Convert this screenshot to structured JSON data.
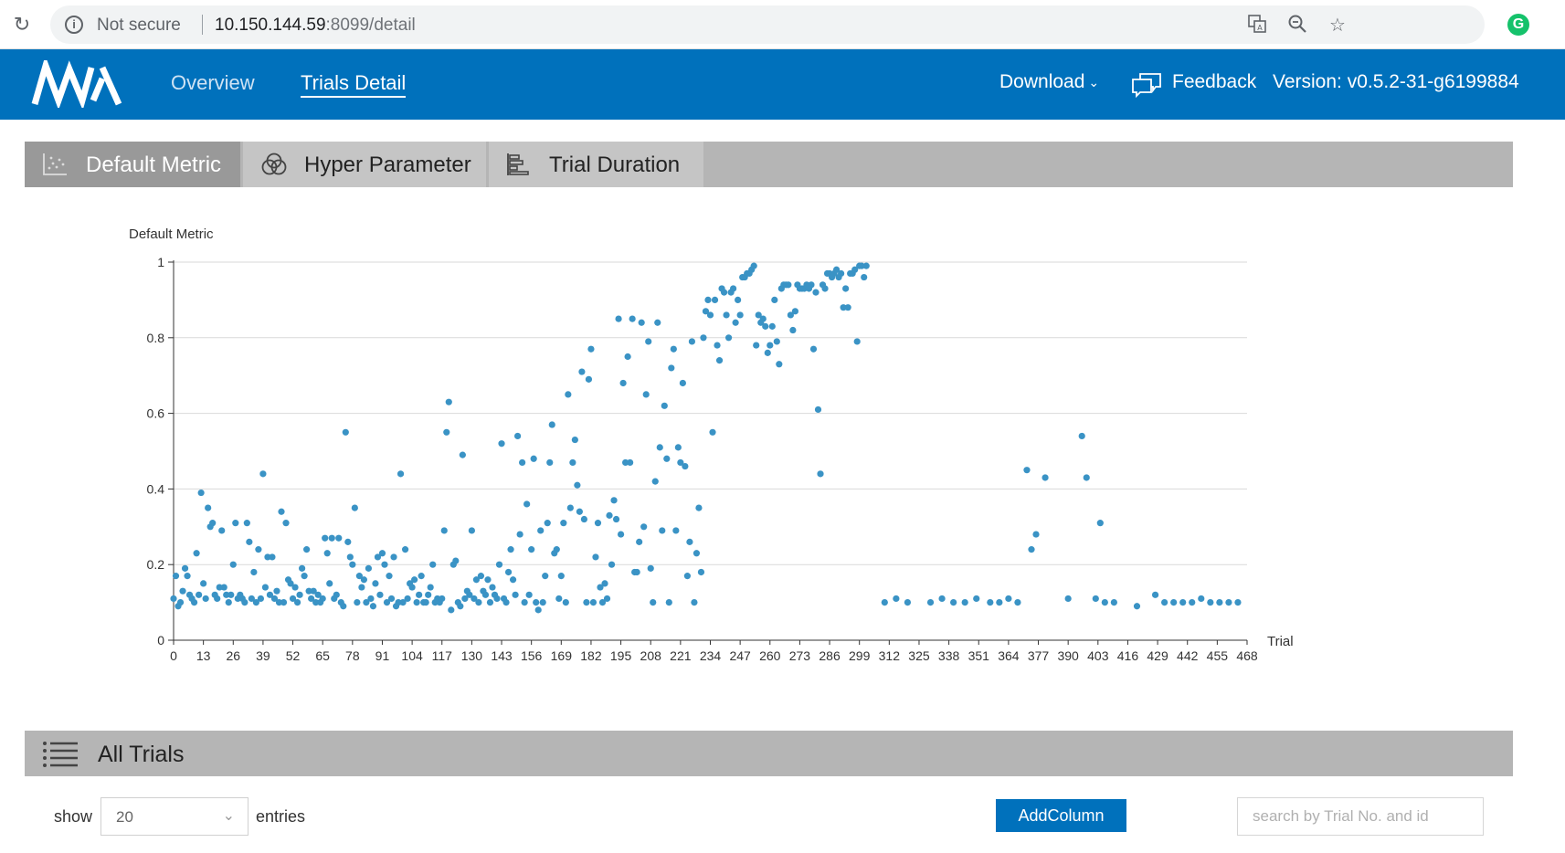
{
  "browser": {
    "security_label": "Not secure",
    "url_host": "10.150.144.59",
    "url_rest": ":8099/detail"
  },
  "header": {
    "nav": [
      {
        "label": "Overview"
      },
      {
        "label": "Trials Detail"
      }
    ],
    "download_label": "Download",
    "feedback_label": "Feedback",
    "version_label": "Version: v0.5.2-31-g6199884"
  },
  "tabs": [
    {
      "label": "Default Metric",
      "active": true
    },
    {
      "label": "Hyper Parameter",
      "active": false
    },
    {
      "label": "Trial Duration",
      "active": false
    }
  ],
  "chart_data": {
    "type": "scatter",
    "ylabel": "Default Metric",
    "xlabel": "Trial",
    "ylim": [
      0,
      1
    ],
    "yticks": [
      "0",
      "0.2",
      "0.4",
      "0.6",
      "0.8",
      "1"
    ],
    "xticks": [
      "0",
      "13",
      "26",
      "39",
      "52",
      "65",
      "78",
      "91",
      "104",
      "117",
      "130",
      "143",
      "156",
      "169",
      "182",
      "195",
      "208",
      "221",
      "234",
      "247",
      "260",
      "273",
      "286",
      "299",
      "312",
      "325",
      "338",
      "351",
      "364",
      "377",
      "390",
      "403",
      "416",
      "429",
      "442",
      "455",
      "468"
    ],
    "grid": true,
    "color": "#3a93c5",
    "points": [
      [
        0,
        0.11
      ],
      [
        1,
        0.17
      ],
      [
        2,
        0.09
      ],
      [
        3,
        0.1
      ],
      [
        4,
        0.13
      ],
      [
        5,
        0.19
      ],
      [
        6,
        0.17
      ],
      [
        7,
        0.12
      ],
      [
        8,
        0.11
      ],
      [
        9,
        0.1
      ],
      [
        10,
        0.23
      ],
      [
        11,
        0.12
      ],
      [
        12,
        0.39
      ],
      [
        13,
        0.15
      ],
      [
        14,
        0.11
      ],
      [
        15,
        0.35
      ],
      [
        16,
        0.3
      ],
      [
        17,
        0.31
      ],
      [
        18,
        0.12
      ],
      [
        19,
        0.11
      ],
      [
        20,
        0.14
      ],
      [
        21,
        0.29
      ],
      [
        22,
        0.14
      ],
      [
        23,
        0.12
      ],
      [
        24,
        0.1
      ],
      [
        25,
        0.12
      ],
      [
        26,
        0.2
      ],
      [
        27,
        0.31
      ],
      [
        28,
        0.11
      ],
      [
        29,
        0.12
      ],
      [
        30,
        0.11
      ],
      [
        31,
        0.1
      ],
      [
        32,
        0.31
      ],
      [
        33,
        0.26
      ],
      [
        34,
        0.11
      ],
      [
        35,
        0.18
      ],
      [
        36,
        0.1
      ],
      [
        37,
        0.24
      ],
      [
        38,
        0.11
      ],
      [
        39,
        0.44
      ],
      [
        40,
        0.14
      ],
      [
        41,
        0.22
      ],
      [
        42,
        0.12
      ],
      [
        43,
        0.22
      ],
      [
        44,
        0.11
      ],
      [
        45,
        0.13
      ],
      [
        46,
        0.1
      ],
      [
        47,
        0.34
      ],
      [
        48,
        0.1
      ],
      [
        49,
        0.31
      ],
      [
        50,
        0.16
      ],
      [
        51,
        0.15
      ],
      [
        52,
        0.11
      ],
      [
        53,
        0.14
      ],
      [
        54,
        0.1
      ],
      [
        55,
        0.12
      ],
      [
        56,
        0.19
      ],
      [
        57,
        0.17
      ],
      [
        58,
        0.24
      ],
      [
        59,
        0.13
      ],
      [
        60,
        0.11
      ],
      [
        61,
        0.13
      ],
      [
        62,
        0.1
      ],
      [
        63,
        0.12
      ],
      [
        64,
        0.1
      ],
      [
        65,
        0.11
      ],
      [
        66,
        0.27
      ],
      [
        67,
        0.23
      ],
      [
        68,
        0.15
      ],
      [
        69,
        0.27
      ],
      [
        70,
        0.11
      ],
      [
        71,
        0.12
      ],
      [
        72,
        0.27
      ],
      [
        73,
        0.1
      ],
      [
        74,
        0.09
      ],
      [
        75,
        0.55
      ],
      [
        76,
        0.26
      ],
      [
        77,
        0.22
      ],
      [
        78,
        0.2
      ],
      [
        79,
        0.35
      ],
      [
        80,
        0.1
      ],
      [
        81,
        0.17
      ],
      [
        82,
        0.14
      ],
      [
        83,
        0.16
      ],
      [
        84,
        0.1
      ],
      [
        85,
        0.19
      ],
      [
        86,
        0.11
      ],
      [
        87,
        0.09
      ],
      [
        88,
        0.15
      ],
      [
        89,
        0.22
      ],
      [
        90,
        0.12
      ],
      [
        91,
        0.23
      ],
      [
        92,
        0.2
      ],
      [
        93,
        0.1
      ],
      [
        94,
        0.17
      ],
      [
        95,
        0.11
      ],
      [
        96,
        0.22
      ],
      [
        97,
        0.09
      ],
      [
        98,
        0.1
      ],
      [
        99,
        0.44
      ],
      [
        100,
        0.1
      ],
      [
        101,
        0.24
      ],
      [
        102,
        0.11
      ],
      [
        103,
        0.15
      ],
      [
        104,
        0.14
      ],
      [
        105,
        0.16
      ],
      [
        106,
        0.1
      ],
      [
        107,
        0.12
      ],
      [
        108,
        0.17
      ],
      [
        109,
        0.1
      ],
      [
        110,
        0.1
      ],
      [
        111,
        0.12
      ],
      [
        112,
        0.14
      ],
      [
        113,
        0.2
      ],
      [
        114,
        0.1
      ],
      [
        115,
        0.11
      ],
      [
        116,
        0.1
      ],
      [
        117,
        0.11
      ],
      [
        118,
        0.29
      ],
      [
        119,
        0.55
      ],
      [
        120,
        0.63
      ],
      [
        121,
        0.08
      ],
      [
        122,
        0.2
      ],
      [
        123,
        0.21
      ],
      [
        124,
        0.1
      ],
      [
        125,
        0.09
      ],
      [
        126,
        0.49
      ],
      [
        127,
        0.11
      ],
      [
        128,
        0.13
      ],
      [
        129,
        0.12
      ],
      [
        130,
        0.29
      ],
      [
        131,
        0.11
      ],
      [
        132,
        0.16
      ],
      [
        133,
        0.1
      ],
      [
        134,
        0.17
      ],
      [
        135,
        0.13
      ],
      [
        136,
        0.12
      ],
      [
        137,
        0.16
      ],
      [
        138,
        0.1
      ],
      [
        139,
        0.14
      ],
      [
        140,
        0.12
      ],
      [
        141,
        0.11
      ],
      [
        142,
        0.2
      ],
      [
        143,
        0.52
      ],
      [
        144,
        0.11
      ],
      [
        145,
        0.1
      ],
      [
        146,
        0.18
      ],
      [
        147,
        0.24
      ],
      [
        148,
        0.16
      ],
      [
        149,
        0.12
      ],
      [
        150,
        0.54
      ],
      [
        151,
        0.28
      ],
      [
        152,
        0.47
      ],
      [
        153,
        0.1
      ],
      [
        154,
        0.36
      ],
      [
        155,
        0.12
      ],
      [
        156,
        0.24
      ],
      [
        157,
        0.48
      ],
      [
        158,
        0.1
      ],
      [
        159,
        0.08
      ],
      [
        160,
        0.29
      ],
      [
        161,
        0.1
      ],
      [
        162,
        0.17
      ],
      [
        163,
        0.31
      ],
      [
        164,
        0.47
      ],
      [
        165,
        0.57
      ],
      [
        166,
        0.23
      ],
      [
        167,
        0.24
      ],
      [
        168,
        0.11
      ],
      [
        169,
        0.17
      ],
      [
        170,
        0.31
      ],
      [
        171,
        0.1
      ],
      [
        172,
        0.65
      ],
      [
        173,
        0.35
      ],
      [
        174,
        0.47
      ],
      [
        175,
        0.53
      ],
      [
        176,
        0.41
      ],
      [
        177,
        0.34
      ],
      [
        178,
        0.71
      ],
      [
        179,
        0.32
      ],
      [
        180,
        0.1
      ],
      [
        181,
        0.69
      ],
      [
        182,
        0.77
      ],
      [
        183,
        0.1
      ],
      [
        184,
        0.22
      ],
      [
        185,
        0.31
      ],
      [
        186,
        0.14
      ],
      [
        187,
        0.1
      ],
      [
        188,
        0.15
      ],
      [
        189,
        0.11
      ],
      [
        190,
        0.33
      ],
      [
        191,
        0.2
      ],
      [
        192,
        0.37
      ],
      [
        193,
        0.32
      ],
      [
        194,
        0.85
      ],
      [
        195,
        0.28
      ],
      [
        196,
        0.68
      ],
      [
        197,
        0.47
      ],
      [
        198,
        0.75
      ],
      [
        199,
        0.47
      ],
      [
        200,
        0.85
      ],
      [
        201,
        0.18
      ],
      [
        202,
        0.18
      ],
      [
        203,
        0.26
      ],
      [
        204,
        0.84
      ],
      [
        205,
        0.3
      ],
      [
        206,
        0.65
      ],
      [
        207,
        0.79
      ],
      [
        208,
        0.19
      ],
      [
        209,
        0.1
      ],
      [
        210,
        0.42
      ],
      [
        211,
        0.84
      ],
      [
        212,
        0.51
      ],
      [
        213,
        0.29
      ],
      [
        214,
        0.62
      ],
      [
        215,
        0.48
      ],
      [
        216,
        0.1
      ],
      [
        217,
        0.72
      ],
      [
        218,
        0.77
      ],
      [
        219,
        0.29
      ],
      [
        220,
        0.51
      ],
      [
        221,
        0.47
      ],
      [
        222,
        0.68
      ],
      [
        223,
        0.46
      ],
      [
        224,
        0.17
      ],
      [
        225,
        0.26
      ],
      [
        226,
        0.79
      ],
      [
        227,
        0.1
      ],
      [
        228,
        0.23
      ],
      [
        229,
        0.35
      ],
      [
        230,
        0.18
      ],
      [
        231,
        0.8
      ],
      [
        232,
        0.87
      ],
      [
        233,
        0.9
      ],
      [
        234,
        0.86
      ],
      [
        235,
        0.55
      ],
      [
        236,
        0.9
      ],
      [
        237,
        0.78
      ],
      [
        238,
        0.74
      ],
      [
        239,
        0.93
      ],
      [
        240,
        0.92
      ],
      [
        241,
        0.86
      ],
      [
        242,
        0.8
      ],
      [
        243,
        0.92
      ],
      [
        244,
        0.93
      ],
      [
        245,
        0.84
      ],
      [
        246,
        0.9
      ],
      [
        247,
        0.86
      ],
      [
        248,
        0.96
      ],
      [
        249,
        0.96
      ],
      [
        250,
        0.97
      ],
      [
        251,
        0.97
      ],
      [
        252,
        0.98
      ],
      [
        253,
        0.99
      ],
      [
        254,
        0.78
      ],
      [
        255,
        0.86
      ],
      [
        256,
        0.84
      ],
      [
        257,
        0.85
      ],
      [
        258,
        0.83
      ],
      [
        259,
        0.76
      ],
      [
        260,
        0.78
      ],
      [
        261,
        0.83
      ],
      [
        262,
        0.9
      ],
      [
        263,
        0.79
      ],
      [
        264,
        0.73
      ],
      [
        265,
        0.93
      ],
      [
        266,
        0.94
      ],
      [
        267,
        0.94
      ],
      [
        268,
        0.94
      ],
      [
        269,
        0.86
      ],
      [
        270,
        0.82
      ],
      [
        271,
        0.87
      ],
      [
        272,
        0.94
      ],
      [
        273,
        0.93
      ],
      [
        274,
        0.93
      ],
      [
        275,
        0.93
      ],
      [
        276,
        0.94
      ],
      [
        277,
        0.93
      ],
      [
        278,
        0.94
      ],
      [
        279,
        0.77
      ],
      [
        280,
        0.92
      ],
      [
        281,
        0.61
      ],
      [
        282,
        0.44
      ],
      [
        283,
        0.94
      ],
      [
        284,
        0.93
      ],
      [
        285,
        0.97
      ],
      [
        286,
        0.97
      ],
      [
        287,
        0.96
      ],
      [
        288,
        0.97
      ],
      [
        289,
        0.98
      ],
      [
        290,
        0.96
      ],
      [
        291,
        0.97
      ],
      [
        292,
        0.88
      ],
      [
        293,
        0.93
      ],
      [
        294,
        0.88
      ],
      [
        295,
        0.97
      ],
      [
        296,
        0.97
      ],
      [
        297,
        0.98
      ],
      [
        298,
        0.79
      ],
      [
        299,
        0.99
      ],
      [
        300,
        0.99
      ],
      [
        301,
        0.96
      ],
      [
        302,
        0.99
      ],
      [
        310,
        0.1
      ],
      [
        315,
        0.11
      ],
      [
        320,
        0.1
      ],
      [
        330,
        0.1
      ],
      [
        335,
        0.11
      ],
      [
        340,
        0.1
      ],
      [
        345,
        0.1
      ],
      [
        350,
        0.11
      ],
      [
        356,
        0.1
      ],
      [
        360,
        0.1
      ],
      [
        364,
        0.11
      ],
      [
        368,
        0.1
      ],
      [
        372,
        0.45
      ],
      [
        374,
        0.24
      ],
      [
        376,
        0.28
      ],
      [
        380,
        0.43
      ],
      [
        390,
        0.11
      ],
      [
        396,
        0.54
      ],
      [
        398,
        0.43
      ],
      [
        402,
        0.11
      ],
      [
        404,
        0.31
      ],
      [
        406,
        0.1
      ],
      [
        410,
        0.1
      ],
      [
        420,
        0.09
      ],
      [
        428,
        0.12
      ],
      [
        432,
        0.1
      ],
      [
        436,
        0.1
      ],
      [
        440,
        0.1
      ],
      [
        444,
        0.1
      ],
      [
        448,
        0.11
      ],
      [
        452,
        0.1
      ],
      [
        456,
        0.1
      ],
      [
        460,
        0.1
      ],
      [
        464,
        0.1
      ]
    ]
  },
  "trials": {
    "title": "All Trials",
    "show_label": "show",
    "entries_label": "entries",
    "page_size": "20",
    "add_column_label": "AddColumn",
    "search_placeholder": "search by Trial No. and id"
  }
}
